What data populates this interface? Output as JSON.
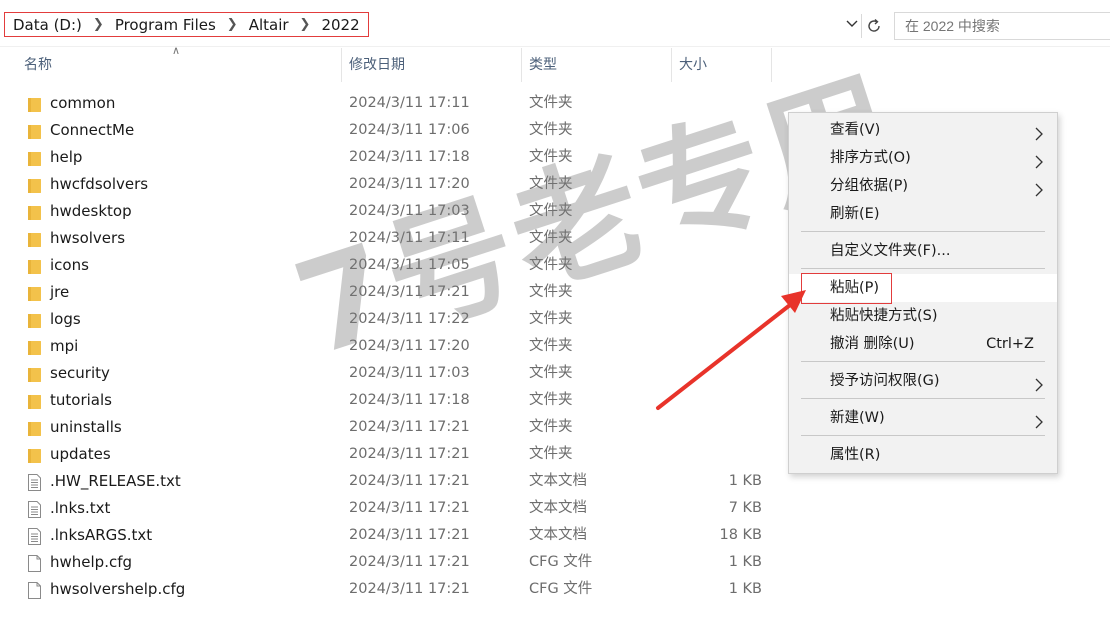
{
  "address": {
    "crumbs": [
      "Data (D:)",
      "Program Files",
      "Altair",
      "2022"
    ],
    "search_placeholder": "在 2022 中搜索"
  },
  "columns": {
    "name": "名称",
    "date": "修改日期",
    "type": "类型",
    "size": "大小"
  },
  "files": [
    {
      "name": "common",
      "date": "2024/3/11 17:11",
      "type": "文件夹",
      "size": "",
      "icon": "folder-icon"
    },
    {
      "name": "ConnectMe",
      "date": "2024/3/11 17:06",
      "type": "文件夹",
      "size": "",
      "icon": "folder-icon"
    },
    {
      "name": "help",
      "date": "2024/3/11 17:18",
      "type": "文件夹",
      "size": "",
      "icon": "folder-icon"
    },
    {
      "name": "hwcfdsolvers",
      "date": "2024/3/11 17:20",
      "type": "文件夹",
      "size": "",
      "icon": "folder-icon"
    },
    {
      "name": "hwdesktop",
      "date": "2024/3/11 17:03",
      "type": "文件夹",
      "size": "",
      "icon": "folder-icon"
    },
    {
      "name": "hwsolvers",
      "date": "2024/3/11 17:11",
      "type": "文件夹",
      "size": "",
      "icon": "folder-icon"
    },
    {
      "name": "icons",
      "date": "2024/3/11 17:05",
      "type": "文件夹",
      "size": "",
      "icon": "folder-icon"
    },
    {
      "name": "jre",
      "date": "2024/3/11 17:21",
      "type": "文件夹",
      "size": "",
      "icon": "folder-icon"
    },
    {
      "name": "logs",
      "date": "2024/3/11 17:22",
      "type": "文件夹",
      "size": "",
      "icon": "folder-icon"
    },
    {
      "name": "mpi",
      "date": "2024/3/11 17:20",
      "type": "文件夹",
      "size": "",
      "icon": "folder-icon"
    },
    {
      "name": "security",
      "date": "2024/3/11 17:03",
      "type": "文件夹",
      "size": "",
      "icon": "folder-icon"
    },
    {
      "name": "tutorials",
      "date": "2024/3/11 17:18",
      "type": "文件夹",
      "size": "",
      "icon": "folder-icon"
    },
    {
      "name": "uninstalls",
      "date": "2024/3/11 17:21",
      "type": "文件夹",
      "size": "",
      "icon": "folder-icon"
    },
    {
      "name": "updates",
      "date": "2024/3/11 17:21",
      "type": "文件夹",
      "size": "",
      "icon": "folder-icon"
    },
    {
      "name": ".HW_RELEASE.txt",
      "date": "2024/3/11 17:21",
      "type": "文本文档",
      "size": "1 KB",
      "icon": "text-file-icon"
    },
    {
      "name": ".lnks.txt",
      "date": "2024/3/11 17:21",
      "type": "文本文档",
      "size": "7 KB",
      "icon": "text-file-icon"
    },
    {
      "name": ".lnksARGS.txt",
      "date": "2024/3/11 17:21",
      "type": "文本文档",
      "size": "18 KB",
      "icon": "text-file-icon"
    },
    {
      "name": "hwhelp.cfg",
      "date": "2024/3/11 17:21",
      "type": "CFG 文件",
      "size": "1 KB",
      "icon": "blank-file-icon"
    },
    {
      "name": "hwsolvershelp.cfg",
      "date": "2024/3/11 17:21",
      "type": "CFG 文件",
      "size": "1 KB",
      "icon": "blank-file-icon"
    }
  ],
  "watermark": "7号老专用",
  "context_menu": {
    "items": [
      {
        "label": "查看(V)",
        "shortcut": "",
        "submenu": true
      },
      {
        "label": "排序方式(O)",
        "shortcut": "",
        "submenu": true
      },
      {
        "label": "分组依据(P)",
        "shortcut": "",
        "submenu": true
      },
      {
        "label": "刷新(E)",
        "shortcut": "",
        "submenu": false
      },
      {
        "label": "自定义文件夹(F)...",
        "shortcut": "",
        "submenu": false
      },
      {
        "label": "粘贴(P)",
        "shortcut": "",
        "submenu": false,
        "highlighted": true
      },
      {
        "label": "粘贴快捷方式(S)",
        "shortcut": "",
        "submenu": false
      },
      {
        "label": "撤消 删除(U)",
        "shortcut": "Ctrl+Z",
        "submenu": false
      },
      {
        "label": "授予访问权限(G)",
        "shortcut": "",
        "submenu": true
      },
      {
        "label": "新建(W)",
        "shortcut": "",
        "submenu": true
      },
      {
        "label": "属性(R)",
        "shortcut": "",
        "submenu": false
      }
    ]
  },
  "colors": {
    "highlight_border": "#e23c3c",
    "arrow": "#e8332a",
    "folder": "#f3c24b",
    "header_text": "#4c607a"
  }
}
